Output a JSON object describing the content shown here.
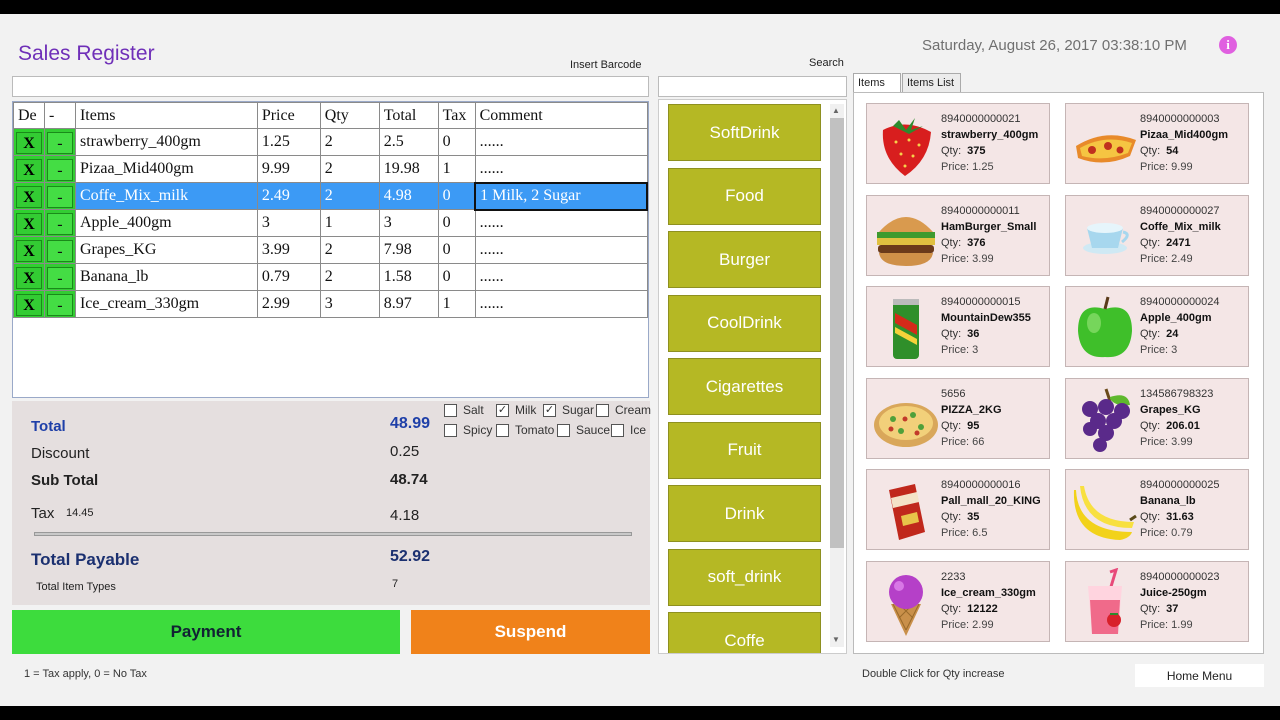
{
  "header": {
    "title": "Sales Register",
    "datetime": "Saturday,  August 26,  2017  03:38:10  PM",
    "info_glyph": "i"
  },
  "barcode": {
    "label": "Insert Barcode",
    "value": ""
  },
  "search": {
    "label": "Search",
    "value": ""
  },
  "grid": {
    "columns": [
      "De",
      "-",
      "Items",
      "Price",
      "Qty",
      "Total",
      "Tax",
      "Comment"
    ],
    "rows": [
      {
        "del": "X",
        "minus": "-",
        "item": "strawberry_400gm",
        "price": "1.25",
        "qty": "2",
        "total": "2.5",
        "tax": "0",
        "comment": "......"
      },
      {
        "del": "X",
        "minus": "-",
        "item": "Pizaa_Mid400gm",
        "price": "9.99",
        "qty": "2",
        "total": "19.98",
        "tax": "1",
        "comment": "......"
      },
      {
        "del": "X",
        "minus": "-",
        "item": "Coffe_Mix_milk",
        "price": "2.49",
        "qty": "2",
        "total": "4.98",
        "tax": "0",
        "comment": "1 Milk, 2 Sugar"
      },
      {
        "del": "X",
        "minus": "-",
        "item": "Apple_400gm",
        "price": "3",
        "qty": "1",
        "total": "3",
        "tax": "0",
        "comment": "......"
      },
      {
        "del": "X",
        "minus": "-",
        "item": "Grapes_KG",
        "price": "3.99",
        "qty": "2",
        "total": "7.98",
        "tax": "0",
        "comment": "......"
      },
      {
        "del": "X",
        "minus": "-",
        "item": "Banana_lb",
        "price": "0.79",
        "qty": "2",
        "total": "1.58",
        "tax": "0",
        "comment": "......"
      },
      {
        "del": "X",
        "minus": "-",
        "item": "Ice_cream_330gm",
        "price": "2.99",
        "qty": "3",
        "total": "8.97",
        "tax": "1",
        "comment": "......"
      }
    ]
  },
  "totals": {
    "total_label": "Total",
    "total_value": "48.99",
    "discount_label": "Discount",
    "discount_value": "0.25",
    "subtotal_label": "Sub Total",
    "subtotal_value": "48.74",
    "tax_label": "Tax",
    "tax_rate": "14.45",
    "tax_value": "4.18",
    "payable_label": "Total Payable",
    "payable_value": "52.92",
    "types_label": "Total Item Types",
    "types_value": "7"
  },
  "options": [
    {
      "label": "Salt",
      "checked": false,
      "mark": ""
    },
    {
      "label": "Milk",
      "checked": true,
      "mark": "✓"
    },
    {
      "label": "Sugar",
      "checked": true,
      "mark": "✓"
    },
    {
      "label": "Cream",
      "checked": false,
      "mark": ""
    },
    {
      "label": "Spicy",
      "checked": false,
      "mark": ""
    },
    {
      "label": "Tomato",
      "checked": false,
      "mark": ""
    },
    {
      "label": "Sauce",
      "checked": false,
      "mark": ""
    },
    {
      "label": "Ice",
      "checked": false,
      "mark": ""
    }
  ],
  "buttons": {
    "payment": "Payment",
    "payment_color": "#3ddc3d",
    "suspend": "Suspend",
    "suspend_color": "#f0821a"
  },
  "tax_note": "1 = Tax apply, 0 = No Tax",
  "categories": [
    "SoftDrink",
    "Food",
    "Burger",
    "CoolDrink",
    "Cigarettes",
    "Fruit",
    "Drink",
    "soft_drink",
    "Coffe"
  ],
  "category_color": "#b5b824",
  "tabs": [
    "Items",
    "Items List"
  ],
  "products": [
    {
      "code": "8940000000021",
      "name": "strawberry_400gm",
      "qty_label": "Qty:",
      "qty": "375",
      "price": "Price: 1.25",
      "icon": "strawberry-icon"
    },
    {
      "code": "8940000000003",
      "name": "Pizaa_Mid400gm",
      "qty_label": "Qty:",
      "qty": "54",
      "price": "Price: 9.99",
      "icon": "pizza-slice-icon"
    },
    {
      "code": "8940000000011",
      "name": "HamBurger_Small",
      "qty_label": "Qty:",
      "qty": "376",
      "price": "Price: 3.99",
      "icon": "hamburger-icon"
    },
    {
      "code": "8940000000027",
      "name": "Coffe_Mix_milk",
      "qty_label": "Qty:",
      "qty": "2471",
      "price": "Price: 2.49",
      "icon": "coffee-cup-icon"
    },
    {
      "code": "8940000000015",
      "name": "MountainDew355",
      "qty_label": "Qty:",
      "qty": "36",
      "price": "Price: 3",
      "icon": "soda-can-icon"
    },
    {
      "code": "8940000000024",
      "name": "Apple_400gm",
      "qty_label": "Qty:",
      "qty": "24",
      "price": "Price: 3",
      "icon": "apple-icon"
    },
    {
      "code": "5656",
      "name": "PIZZA_2KG",
      "qty_label": "Qty:",
      "qty": "95",
      "price": "Price: 66",
      "icon": "pizza-icon"
    },
    {
      "code": "134586798323",
      "name": "Grapes_KG",
      "qty_label": "Qty:",
      "qty": "206.01",
      "price": "Price: 3.99",
      "icon": "grapes-icon"
    },
    {
      "code": "8940000000016",
      "name": "Pall_mall_20_KING",
      "qty_label": "Qty:",
      "qty": "35",
      "price": "Price: 6.5",
      "icon": "cigarette-pack-icon"
    },
    {
      "code": "8940000000025",
      "name": "Banana_lb",
      "qty_label": "Qty:",
      "qty": "31.63",
      "price": "Price: 0.79",
      "icon": "banana-icon"
    },
    {
      "code": "2233",
      "name": "Ice_cream_330gm",
      "qty_label": "Qty:",
      "qty": "12122",
      "price": "Price: 2.99",
      "icon": "ice-cream-icon"
    },
    {
      "code": "8940000000023",
      "name": "Juice-250gm",
      "qty_label": "Qty:",
      "qty": "37",
      "price": "Price: 1.99",
      "icon": "juice-icon"
    }
  ],
  "hint": "Double Click for Qty increase",
  "home_menu": "Home Menu"
}
